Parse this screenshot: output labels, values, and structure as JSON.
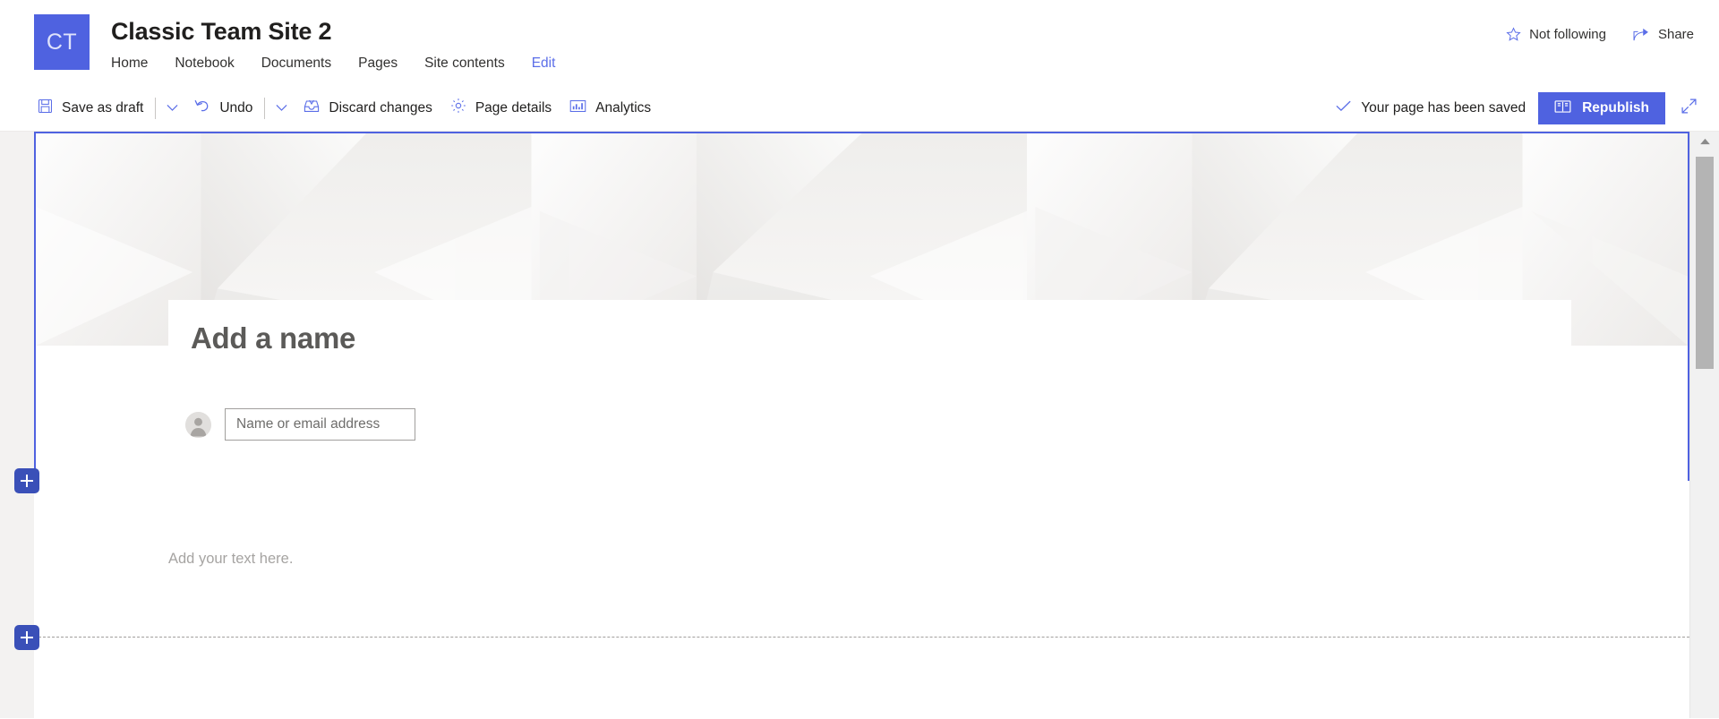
{
  "site": {
    "logo_initials": "CT",
    "logo_color": "#4F62E0",
    "title": "Classic Team Site 2",
    "nav": [
      {
        "label": "Home",
        "active": false
      },
      {
        "label": "Notebook",
        "active": false
      },
      {
        "label": "Documents",
        "active": false
      },
      {
        "label": "Pages",
        "active": false
      },
      {
        "label": "Site contents",
        "active": false
      },
      {
        "label": "Edit",
        "active": true
      }
    ],
    "actions": {
      "follow_label": "Not following",
      "follow_icon": "star-outline-icon",
      "share_label": "Share",
      "share_icon": "share-icon"
    }
  },
  "command_bar": {
    "save_as_draft": "Save as draft",
    "save_icon": "save-floppy-icon",
    "save_chevron_icon": "chevron-down-icon",
    "undo": "Undo",
    "undo_icon": "undo-arrow-icon",
    "undo_chevron_icon": "chevron-down-icon",
    "discard_changes": "Discard changes",
    "discard_icon": "discard-tray-icon",
    "page_details": "Page details",
    "page_details_icon": "gear-icon",
    "analytics": "Analytics",
    "analytics_icon": "bar-chart-icon",
    "saved_status": "Your page has been saved",
    "saved_status_icon": "checkmark-icon",
    "republish": "Republish",
    "republish_icon": "book-icon",
    "republish_color": "#4F62E0",
    "expand_icon": "expand-diagonal-icon"
  },
  "canvas": {
    "hero": {
      "title_placeholder": "Add a name",
      "person_avatar_icon": "person-placeholder-icon",
      "person_placeholder": "Name or email address",
      "person_value": "",
      "selected_outline_color": "#4F62E0"
    },
    "add_section_top": {
      "label": "+",
      "icon": "plus-icon"
    },
    "add_section_bottom": {
      "label": "+",
      "icon": "plus-icon"
    },
    "text_webpart": {
      "placeholder": "Add your text here."
    }
  },
  "scrollbar": {
    "up_arrow_icon": "caret-up-icon",
    "thumb": "scroll-thumb"
  }
}
